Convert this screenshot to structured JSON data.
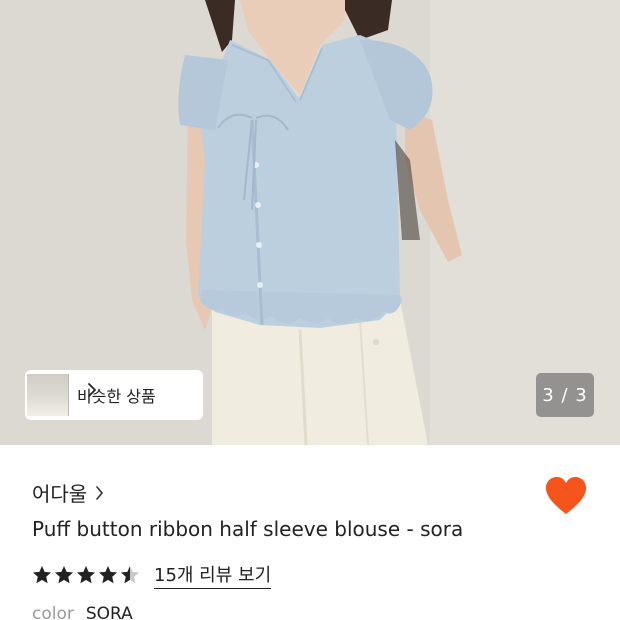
{
  "similar": {
    "label": "비슷한 상품"
  },
  "gallery": {
    "current": 3,
    "total": 3,
    "counter_text": "3 / 3"
  },
  "product": {
    "brand": "어다울",
    "title": "Puff button ribbon half sleeve blouse - sora",
    "rating": 4.5,
    "review_link": "15개 리뷰 보기",
    "wishlisted": true,
    "option_label": "color",
    "option_value": "SORA"
  },
  "colors": {
    "heart": "#f5541c",
    "star": "#222222",
    "blouse": "#bccfdf",
    "trousers": "#f1ece0"
  }
}
